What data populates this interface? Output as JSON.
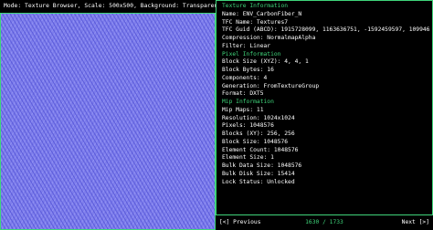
{
  "header": {
    "mode_text": "Mode: Texture Browser, Scale: 500x500, Background: Transparent"
  },
  "preview": {
    "content": "Carbon fiber normal map texture preview"
  },
  "info": {
    "texture_section": "Texture Information",
    "name": "Name: ENV_CarbonFiber_N",
    "tfc_name": "TFC Name: Textures7",
    "tfc_guid": "TFC Guid (ABCD): 1915728099, 1163636751, -1592459597, 1099463001",
    "compression": "Compression: NormalmapAlpha",
    "filter": "Filter: Linear",
    "pixel_section": "Pixel Information",
    "block_size_xyz": "Block Size (XYZ): 4, 4, 1",
    "block_bytes": "Block Bytes: 16",
    "components": "Components: 4",
    "generation": "Generation: FromTextureGroup",
    "format": "Format: DXT5",
    "mip_section": "Mip Information",
    "mip_maps": "Mip Maps: 11",
    "resolution": "Resolution: 1024x1024",
    "pixels": "Pixels: 1048576",
    "blocks_xy": "Blocks (XY): 256, 256",
    "block_size": "Block Size: 1048576",
    "element_count": "Element Count: 1048576",
    "element_size": "Element Size: 1",
    "bulk_data_size": "Bulk Data Size: 1048576",
    "bulk_disk_size": "Bulk Disk Size: 15414",
    "lock_status": "Lock Status: Unlocked"
  },
  "footer": {
    "prev_label": "[<] Previous",
    "counter": "1630 / 1733",
    "next_label": "Next [>]"
  },
  "colors": {
    "accent": "#3fd47a",
    "background": "#000000",
    "text": "#ffffff",
    "texture_base": "#7f7fea"
  }
}
